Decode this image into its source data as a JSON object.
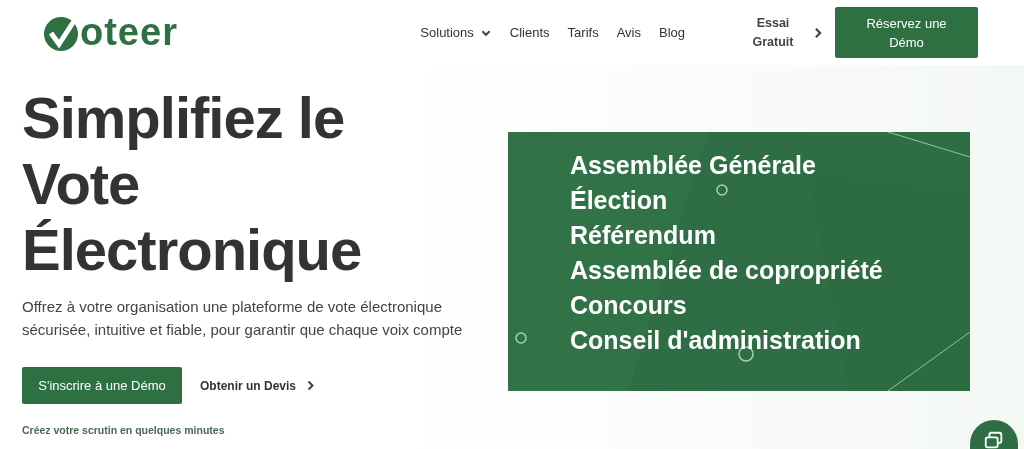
{
  "header": {
    "logo_text": "oteer",
    "nav": [
      {
        "label": "Solutions",
        "dropdown": true
      },
      {
        "label": "Clients",
        "dropdown": false
      },
      {
        "label": "Tarifs",
        "dropdown": false
      },
      {
        "label": "Avis",
        "dropdown": false
      },
      {
        "label": "Blog",
        "dropdown": false
      }
    ],
    "trial_link": "Essai Gratuit",
    "demo_button": "Réservez une Démo"
  },
  "hero": {
    "title_lines": [
      "Simplifiez le",
      "Vote",
      "Électronique"
    ],
    "description": "Offrez à votre organisation une plateforme de vote électronique sécurisée, intuitive et fiable, pour garantir que chaque voix compte",
    "primary_button": "S'inscrire à une Démo",
    "secondary_link": "Obtenir un Devis",
    "note": "Créez votre scrutin en quelques minutes",
    "panel_items": [
      "Assemblée Générale",
      "Élection",
      "Référendum",
      "Assemblée de copropriété",
      "Concours",
      "Conseil d'administration"
    ]
  }
}
